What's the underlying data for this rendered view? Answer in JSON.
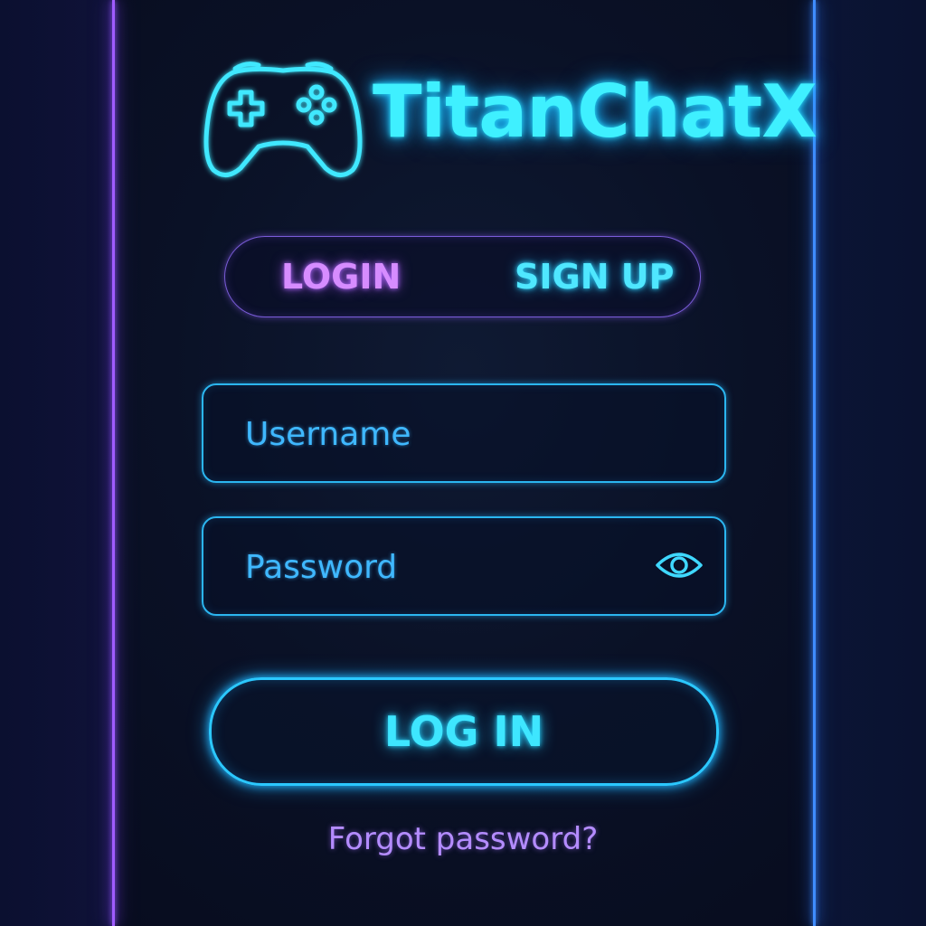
{
  "app": {
    "title": "TitanChatX",
    "logo_icon": "gamepad-icon"
  },
  "tabs": {
    "login_label": "LOGIN",
    "signup_label": "SIGN UP",
    "active": "login"
  },
  "form": {
    "username": {
      "value": "",
      "placeholder": "Username"
    },
    "password": {
      "value": "",
      "placeholder": "Password",
      "toggle_icon": "eye-icon"
    },
    "submit_label": "LOG IN",
    "forgot_label": "Forgot password?"
  },
  "colors": {
    "primary_cyan": "#3ff0ff",
    "accent_purple": "#b368ff",
    "background": "#070b1d"
  }
}
